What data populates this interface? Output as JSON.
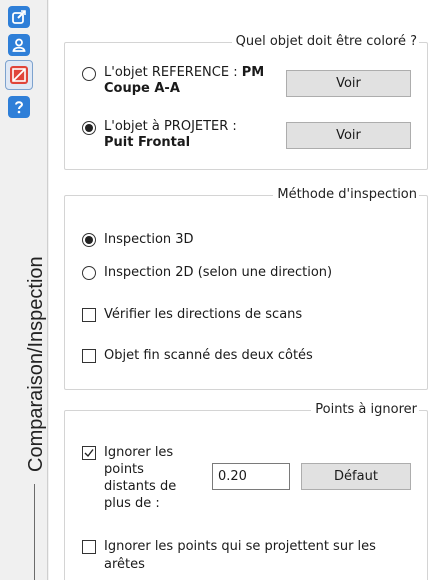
{
  "sidebar": {
    "tab_title": "Comparaison/Inspection",
    "tools": [
      {
        "icon": "edit-icon",
        "color": "#2f7fd8"
      },
      {
        "icon": "user-icon",
        "color": "#2f7fd8"
      },
      {
        "icon": "no-image-icon",
        "color": "#e0443a"
      },
      {
        "icon": "help-icon",
        "color": "#2f7fd8"
      }
    ]
  },
  "color_group": {
    "title": "Quel objet doit être coloré ?",
    "reference": {
      "label_prefix": "L'objet REFERENCE : ",
      "label_bold": "PM",
      "sub_bold": "Coupe A-A",
      "selected": false,
      "button": "Voir"
    },
    "project": {
      "label_prefix": "L'objet à PROJETER :",
      "sub_bold": "Puit Frontal",
      "selected": true,
      "button": "Voir"
    }
  },
  "inspection_group": {
    "title": "Méthode d'inspection",
    "options": [
      {
        "label": "Inspection 3D",
        "selected": true
      },
      {
        "label": "Inspection 2D (selon une direction)",
        "selected": false
      }
    ],
    "checks": [
      {
        "label": "Vérifier les directions de scans",
        "checked": false
      },
      {
        "label": "Objet fin scanné des deux côtés",
        "checked": false
      }
    ]
  },
  "ignore_group": {
    "title": "Points à ignorer",
    "distant": {
      "line1": "Ignorer les",
      "line2": "points",
      "line3": "distants de",
      "line4": "plus de :",
      "checked": true,
      "value": "0.20",
      "button": "Défaut"
    },
    "edges": {
      "line1": "Ignorer les points qui se projettent sur les",
      "line2": "arêtes",
      "checked": false
    }
  }
}
